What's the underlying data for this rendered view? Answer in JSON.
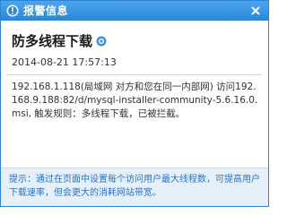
{
  "window": {
    "title": "报警信息"
  },
  "alert": {
    "heading": "防多线程下载",
    "timestamp": "2014-08-21 17:57:13",
    "message": "192.168.1.118(局域网 对方和您在同一内部网) 访问192.168.9.188:82/d/mysql-installer-community-5.6.16.0.msi, 触发规则：多线程下载，已被拦截。"
  },
  "footer": {
    "tip": "提示：通过在页面中设置每个访问用户最大线程数，可提高用户下载速率，但会更大的消耗网站带宽。"
  },
  "icons": {
    "title_icon": "alert-shield-icon",
    "close_icon": "close-icon",
    "info_icon": "info-gear-icon"
  },
  "colors": {
    "titlebar": "#2a86d6",
    "footer_bg": "#e6f0fb",
    "tip_text": "#2a73c4"
  }
}
